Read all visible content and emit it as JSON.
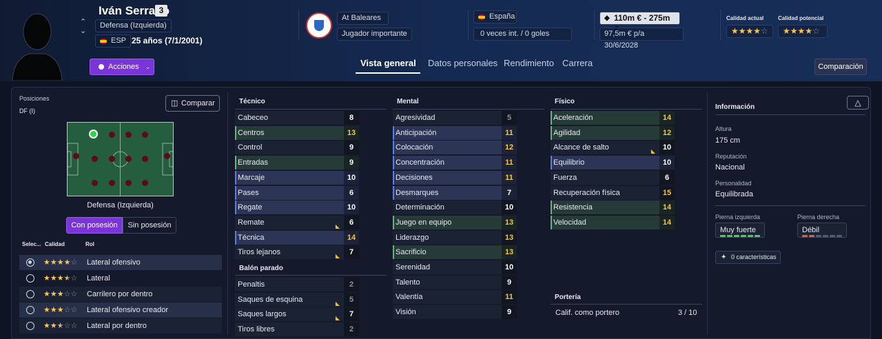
{
  "player": {
    "name": "Iván Serrano",
    "number": "3",
    "position": "Defensa (Izquierda)",
    "nation_code": "ESP",
    "age": "25 años (7/1/2001)"
  },
  "club": {
    "name": "At Baleares",
    "role": "Jugador importante"
  },
  "nation": {
    "name": "España",
    "caps": "0 veces int. / 0 goles"
  },
  "value": {
    "range": "110m € - 275m €",
    "wage": "97,5m € p/a",
    "contract": "30/6/2028"
  },
  "ability": {
    "current_label": "Calidad actual",
    "current_stars": 4,
    "potential_label": "Calidad potencial",
    "potential_stars": 4
  },
  "actions_label": "Acciones",
  "tabs": [
    "Vista general",
    "Datos personales",
    "Rendimiento",
    "Carrera"
  ],
  "comparison_label": "Comparación",
  "positions": {
    "title": "Posiciones",
    "short": "DF (I)",
    "compare_label": "Comparar",
    "pitch_label": "Defensa (Izquierda)",
    "with_ball": "Con posesión",
    "without_ball": "Sin posesión"
  },
  "roles": {
    "headers": [
      "Selec...",
      "Calidad",
      "Rol"
    ],
    "items": [
      {
        "name": "Lateral ofensivo",
        "stars": 4,
        "selected": true
      },
      {
        "name": "Lateral",
        "stars": 3.5,
        "selected": false
      },
      {
        "name": "Carrilero por dentro",
        "stars": 3,
        "selected": false
      },
      {
        "name": "Lateral ofensivo creador",
        "stars": 3,
        "selected": false
      },
      {
        "name": "Lateral por dentro",
        "stars": 2.5,
        "selected": false
      }
    ]
  },
  "tecnico": {
    "title": "Técnico",
    "items": [
      {
        "name": "Cabeceo",
        "value": "8",
        "style": "n",
        "arrow": false,
        "color": "#ffffff"
      },
      {
        "name": "Centros",
        "value": "13",
        "style": "g",
        "arrow": false,
        "color": "#f5c542"
      },
      {
        "name": "Control",
        "value": "9",
        "style": "n",
        "arrow": false,
        "color": "#ffffff"
      },
      {
        "name": "Entradas",
        "value": "9",
        "style": "g",
        "arrow": false,
        "color": "#ffffff"
      },
      {
        "name": "Marcaje",
        "value": "10",
        "style": "p",
        "arrow": false,
        "color": "#ffffff"
      },
      {
        "name": "Pases",
        "value": "6",
        "style": "p",
        "arrow": false,
        "color": "#ffffff"
      },
      {
        "name": "Regate",
        "value": "10",
        "style": "p",
        "arrow": false,
        "color": "#ffffff"
      },
      {
        "name": "Remate",
        "value": "6",
        "style": "n",
        "arrow": true,
        "color": "#ffffff"
      },
      {
        "name": "Técnica",
        "value": "14",
        "style": "p",
        "arrow": false,
        "color": "#f5c542"
      },
      {
        "name": "Tiros lejanos",
        "value": "7",
        "style": "n",
        "arrow": true,
        "color": "#ffffff"
      }
    ]
  },
  "balon_parado": {
    "title": "Balón parado",
    "items": [
      {
        "name": "Penaltis",
        "value": "2",
        "style": "n",
        "arrow": false,
        "color": "#8a90a0"
      },
      {
        "name": "Saques de esquina",
        "value": "5",
        "style": "n",
        "arrow": true,
        "color": "#8a90a0"
      },
      {
        "name": "Saques largos",
        "value": "7",
        "style": "n",
        "arrow": true,
        "color": "#ffffff"
      },
      {
        "name": "Tiros libres",
        "value": "2",
        "style": "n",
        "arrow": false,
        "color": "#8a90a0"
      }
    ]
  },
  "mental": {
    "title": "Mental",
    "items": [
      {
        "name": "Agresividad",
        "value": "5",
        "style": "n",
        "arrow": false,
        "color": "#8a90a0"
      },
      {
        "name": "Anticipación",
        "value": "11",
        "style": "p",
        "arrow": false,
        "color": "#f5c542"
      },
      {
        "name": "Colocación",
        "value": "12",
        "style": "p",
        "arrow": false,
        "color": "#f5c542"
      },
      {
        "name": "Concentración",
        "value": "11",
        "style": "p",
        "arrow": false,
        "color": "#f5c542"
      },
      {
        "name": "Decisiones",
        "value": "11",
        "style": "p",
        "arrow": false,
        "color": "#f5c542"
      },
      {
        "name": "Desmarques",
        "value": "7",
        "style": "p",
        "arrow": false,
        "color": "#ffffff"
      },
      {
        "name": "Determinación",
        "value": "10",
        "style": "n",
        "arrow": false,
        "color": "#ffffff"
      },
      {
        "name": "Juego en equipo",
        "value": "13",
        "style": "g",
        "arrow": false,
        "color": "#f5c542"
      },
      {
        "name": "Liderazgo",
        "value": "13",
        "style": "n",
        "arrow": false,
        "color": "#f5c542"
      },
      {
        "name": "Sacrificio",
        "value": "13",
        "style": "g",
        "arrow": false,
        "color": "#f5c542"
      },
      {
        "name": "Serenidad",
        "value": "10",
        "style": "n",
        "arrow": false,
        "color": "#ffffff"
      },
      {
        "name": "Talento",
        "value": "9",
        "style": "n",
        "arrow": false,
        "color": "#ffffff"
      },
      {
        "name": "Valentía",
        "value": "11",
        "style": "n",
        "arrow": false,
        "color": "#f5c542"
      },
      {
        "name": "Visión",
        "value": "9",
        "style": "n",
        "arrow": false,
        "color": "#ffffff"
      }
    ]
  },
  "fisico": {
    "title": "Físico",
    "items": [
      {
        "name": "Aceleración",
        "value": "14",
        "style": "g",
        "arrow": false,
        "color": "#f5c542"
      },
      {
        "name": "Agilidad",
        "value": "12",
        "style": "g",
        "arrow": false,
        "color": "#f5c542"
      },
      {
        "name": "Alcance de salto",
        "value": "10",
        "style": "n",
        "arrow": true,
        "color": "#ffffff"
      },
      {
        "name": "Equilibrio",
        "value": "10",
        "style": "p",
        "arrow": false,
        "color": "#ffffff"
      },
      {
        "name": "Fuerza",
        "value": "6",
        "style": "n",
        "arrow": false,
        "color": "#ffffff"
      },
      {
        "name": "Recuperación física",
        "value": "15",
        "style": "n",
        "arrow": false,
        "color": "#f5c542"
      },
      {
        "name": "Resistencia",
        "value": "14",
        "style": "g",
        "arrow": false,
        "color": "#f5c542"
      },
      {
        "name": "Velocidad",
        "value": "14",
        "style": "g",
        "arrow": false,
        "color": "#f5c542"
      }
    ]
  },
  "porteria": {
    "title": "Portería",
    "label": "Calif. como portero",
    "value": "3 / 10"
  },
  "info": {
    "title": "Información",
    "height_label": "Altura",
    "height": "175 cm",
    "rep_label": "Reputación",
    "rep": "Nacional",
    "pers_label": "Personalidad",
    "pers": "Equilibrada",
    "left_foot_label": "Pierna izquierda",
    "left_foot": "Muy fuerte",
    "right_foot_label": "Pierna derecha",
    "right_foot": "Débil",
    "traits": "0 características"
  }
}
